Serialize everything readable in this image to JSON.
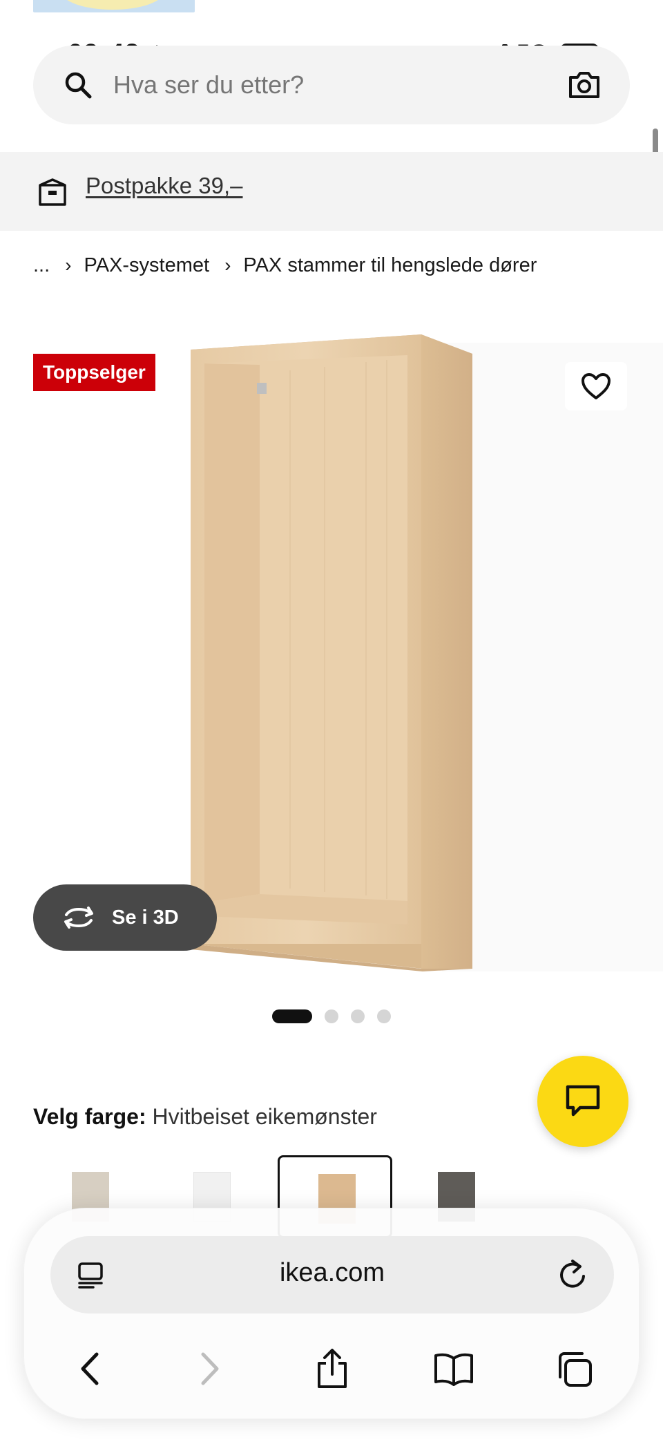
{
  "status_bar": {
    "time": "09:43",
    "network": "5G"
  },
  "search": {
    "placeholder": "Hva ser du etter?"
  },
  "delivery_banner": {
    "label": "Postpakke 39,–"
  },
  "breadcrumb": {
    "ellipsis": "...",
    "items": [
      "PAX-systemet",
      "PAX stammer til hengslede dører"
    ]
  },
  "product": {
    "badge": "Toppselger",
    "view_3d_label": "Se i 3D",
    "image_count": 4,
    "active_image": 1,
    "color_label": "Velg farge:",
    "color_value": "Hvitbeiset eikemønster",
    "swatches": [
      {
        "name": "beige",
        "color": "#d7cfc2",
        "selected": false
      },
      {
        "name": "white",
        "color": "#f1f1f1",
        "selected": false
      },
      {
        "name": "white-stained-oak",
        "color": "#dcb990",
        "selected": true
      },
      {
        "name": "dark-grey",
        "color": "#5f5c58",
        "selected": false
      }
    ]
  },
  "browser": {
    "url": "ikea.com"
  },
  "colors": {
    "badge_red": "#cc0008",
    "chat_yellow": "#fbd914",
    "button_dark": "#484848"
  }
}
